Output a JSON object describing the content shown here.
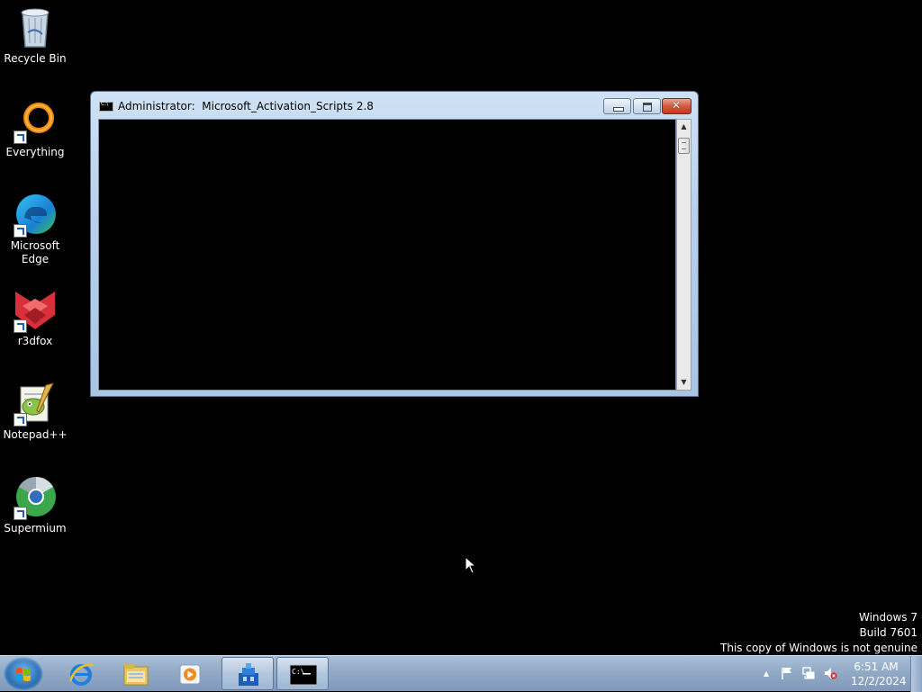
{
  "desktop": {
    "icons": [
      {
        "label": "Recycle Bin"
      },
      {
        "label": "Everything"
      },
      {
        "label": "Microsoft Edge"
      },
      {
        "label": "r3dfox"
      },
      {
        "label": "Notepad++"
      },
      {
        "label": "Supermium"
      }
    ]
  },
  "window": {
    "title": "Administrator:  Microsoft_Activation_Scripts 2.8",
    "buttons": {
      "minimize": "minimize",
      "maximize": "maximize",
      "close": "close"
    }
  },
  "watermark": {
    "line1": "Windows 7",
    "line2": "Build 7601",
    "line3": "This copy of Windows is not genuine"
  },
  "taskbar": {
    "pinned": [
      {
        "icon": "internet-explorer-icon"
      },
      {
        "icon": "file-explorer-icon"
      },
      {
        "icon": "media-player-icon"
      },
      {
        "icon": "store-app-icon",
        "active": true
      },
      {
        "icon": "command-prompt-icon",
        "active": true
      }
    ],
    "clock": {
      "time": "6:51 AM",
      "date": "12/2/2024"
    }
  },
  "colors": {
    "taskbar": "#93aac6",
    "window_frame": "#b8d0ea",
    "console_bg": "#000000"
  }
}
